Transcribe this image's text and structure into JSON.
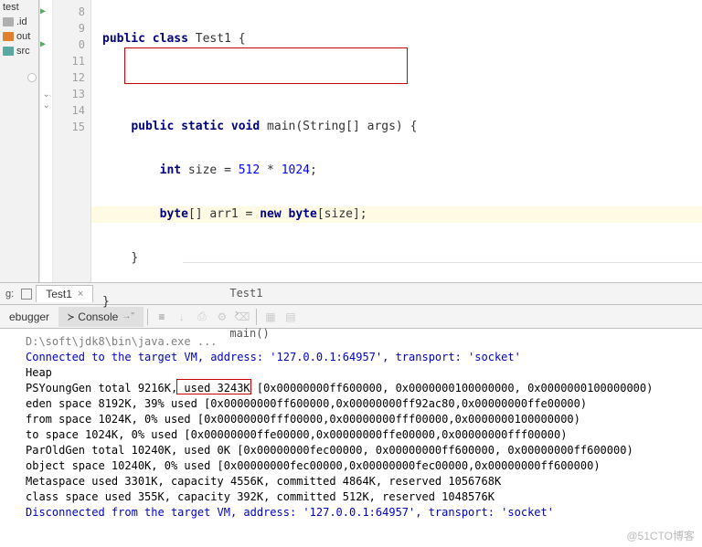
{
  "sidebar": {
    "items": [
      {
        "label": "test"
      },
      {
        "label": ".id"
      },
      {
        "label": "out"
      },
      {
        "label": "src"
      }
    ]
  },
  "gutter": {
    "lines": [
      "8",
      "9",
      "0",
      "11",
      "12",
      "13",
      "14",
      "15"
    ]
  },
  "code": {
    "l8_kw1": "public",
    "l8_kw2": "class",
    "l8_cls": " Test1 {",
    "l10_kw1": "public",
    "l10_kw2": "static",
    "l10_kw3": "void",
    "l10_rest": " main(String[] args) {",
    "l11_kw": "int",
    "l11_mid": " size = ",
    "l11_n1": "512",
    "l11_op": " * ",
    "l11_n2": "1024",
    "l11_semi": ";",
    "l12_kw1": "byte",
    "l12_arr": "[] arr1 = ",
    "l12_kw2": "new",
    "l12_kw3": " byte",
    "l12_rest": "[size];",
    "l13": "}",
    "l14": "}"
  },
  "breadcrumb": {
    "a": "Test1",
    "b": "main()"
  },
  "tab": {
    "name": "Test1"
  },
  "toolrow": {
    "debugger": "ebugger",
    "console": "Console",
    "arrow": "→\""
  },
  "console": {
    "cmd": "D:\\soft\\jdk8\\bin\\java.exe ...",
    "conn": "Connected to the target VM, address: '127.0.0.1:64957', transport: 'socket'",
    "heap": "Heap",
    "l1": "PSYoungGen      total 9216K, used 3243K [0x00000000ff600000, 0x0000000100000000, 0x0000000100000000)",
    "l2": " eden space 8192K, 39% used [0x00000000ff600000,0x00000000ff92ac80,0x00000000ffe00000)",
    "l3": " from space 1024K, 0% used [0x00000000fff00000,0x00000000fff00000,0x0000000100000000)",
    "l4": " to   space 1024K, 0% used [0x00000000ffe00000,0x00000000ffe00000,0x00000000fff00000)",
    "l5": "ParOldGen       total 10240K, used 0K [0x00000000fec00000, 0x00000000ff600000, 0x00000000ff600000)",
    "l6": " object space 10240K, 0% used [0x00000000fec00000,0x00000000fec00000,0x00000000ff600000)",
    "l7": "Metaspace       used 3301K, capacity 4556K, committed 4864K, reserved 1056768K",
    "l8": " class space    used 355K, capacity 392K, committed 512K, reserved 1048576K",
    "disc": "Disconnected from the target VM, address: '127.0.0.1:64957', transport: 'socket'"
  },
  "watermark": "@51CTO博客",
  "left_label": "g:"
}
